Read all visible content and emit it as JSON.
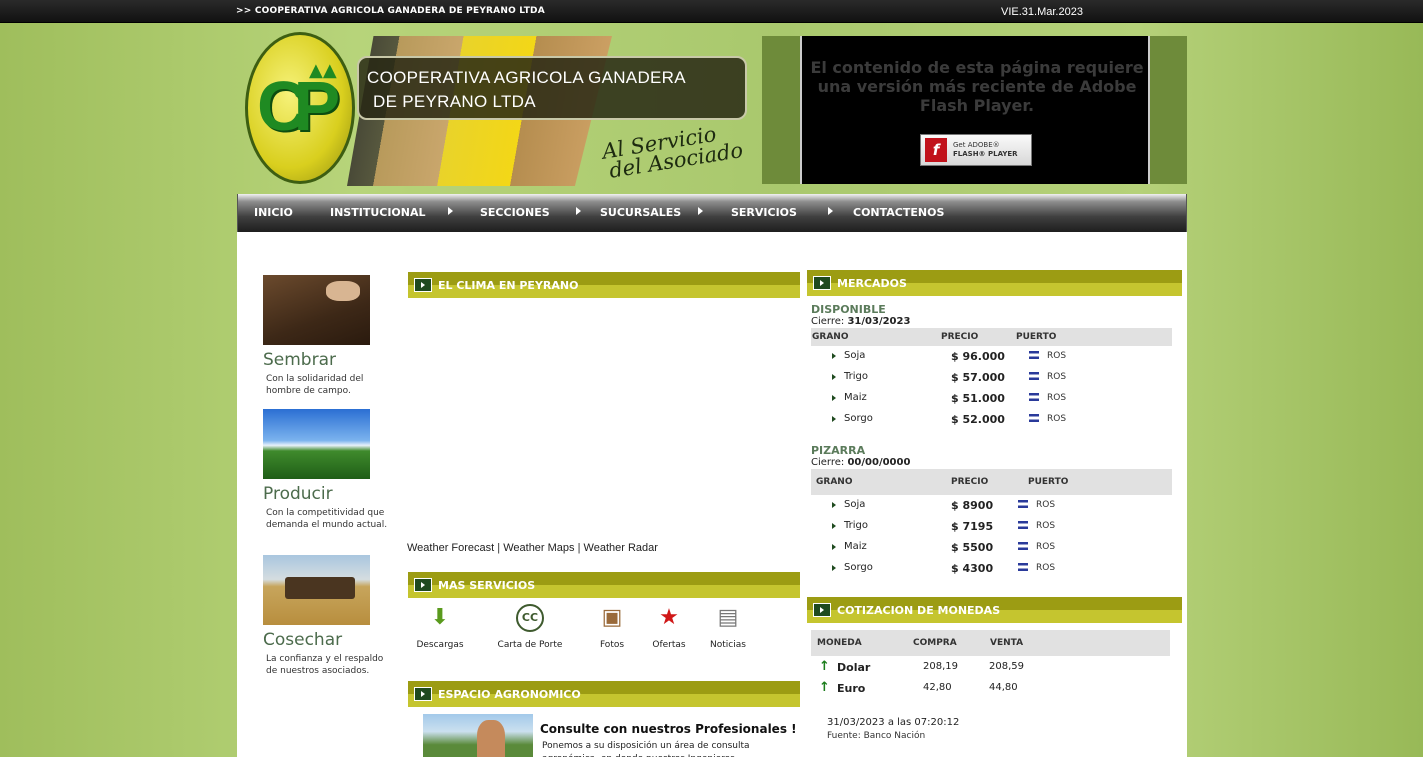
{
  "topbar": {
    "title": ">> COOPERATIVA AGRICOLA GANADERA DE PEYRANO LTDA",
    "date": "VIE.31.Mar.2023"
  },
  "header": {
    "logo_letters": "CP",
    "name_line1": "COOPERATIVA AGRICOLA GANADERA",
    "name_line2": "DE PEYRANO LTDA",
    "slogan_line1": "Al Servicio",
    "slogan_line2": "del Asociado"
  },
  "flash": {
    "message": "El contenido de esta página requiere una versión más reciente de Adobe Flash Player.",
    "btn_line1": "Get ADOBE®",
    "btn_line2": "FLASH® PLAYER",
    "btn_icon": "f"
  },
  "nav": {
    "items": [
      "INICIO",
      "INSTITUCIONAL",
      "SECCIONES",
      "SUCURSALES",
      "SERVICIOS",
      "CONTACTENOS"
    ]
  },
  "left": {
    "items": [
      {
        "title": "Sembrar",
        "text": "Con la solidaridad del hombre de campo."
      },
      {
        "title": "Producir",
        "text": "Con la competitividad que demanda el mundo actual."
      },
      {
        "title": "Cosechar",
        "text": "La confianza y el respaldo de nuestros asociados."
      }
    ]
  },
  "clima": {
    "title": "EL CLIMA EN PEYRANO",
    "link1": "Weather Forecast",
    "link2": "Weather Maps",
    "link3": "Weather Radar",
    "sep": "|"
  },
  "servicios": {
    "title": "MAS SERVICIOS",
    "items": [
      {
        "label": "Descargas",
        "icon": "download-icon",
        "glyph": "⬇"
      },
      {
        "label": "Carta de Porte",
        "icon": "cc-icon",
        "glyph": "CC"
      },
      {
        "label": "Fotos",
        "icon": "photos-icon",
        "glyph": "▣"
      },
      {
        "label": "Ofertas",
        "icon": "star-icon",
        "glyph": "★"
      },
      {
        "label": "Noticias",
        "icon": "newspaper-icon",
        "glyph": "▤"
      }
    ]
  },
  "agro": {
    "title": "ESPACIO AGRONOMICO",
    "heading": "Consulte con nuestros Profesionales !",
    "text": "Ponemos a su disposición un área de consulta agronómica, en donde nuestros Ingenieros"
  },
  "mercados": {
    "title": "MERCADOS",
    "disponible": {
      "label": "DISPONIBLE",
      "cierre_label": "Cierre:",
      "cierre_date": "31/03/2023",
      "headers": [
        "GRANO",
        "PRECIO",
        "PUERTO"
      ],
      "rows": [
        {
          "grano": "Soja",
          "precio": "$ 96.000",
          "puerto": "ROS"
        },
        {
          "grano": "Trigo",
          "precio": "$ 57.000",
          "puerto": "ROS"
        },
        {
          "grano": "Maiz",
          "precio": "$ 51.000",
          "puerto": "ROS"
        },
        {
          "grano": "Sorgo",
          "precio": "$ 52.000",
          "puerto": "ROS"
        }
      ]
    },
    "pizarra": {
      "label": "PIZARRA",
      "cierre_label": "Cierre:",
      "cierre_date": "00/00/0000",
      "headers": [
        "GRANO",
        "PRECIO",
        "PUERTO"
      ],
      "rows": [
        {
          "grano": "Soja",
          "precio": "$ 8900",
          "puerto": "ROS"
        },
        {
          "grano": "Trigo",
          "precio": "$ 7195",
          "puerto": "ROS"
        },
        {
          "grano": "Maiz",
          "precio": "$ 5500",
          "puerto": "ROS"
        },
        {
          "grano": "Sorgo",
          "precio": "$ 4300",
          "puerto": "ROS"
        }
      ]
    }
  },
  "monedas": {
    "title": "COTIZACION DE MONEDAS",
    "headers": [
      "MONEDA",
      "COMPRA",
      "VENTA"
    ],
    "rows": [
      {
        "moneda": "Dolar",
        "compra": "208,19",
        "venta": "208,59"
      },
      {
        "moneda": "Euro",
        "compra": "42,80",
        "venta": "44,80"
      }
    ],
    "updated": "31/03/2023 a las 07:20:12",
    "source": "Fuente: Banco Nación"
  }
}
